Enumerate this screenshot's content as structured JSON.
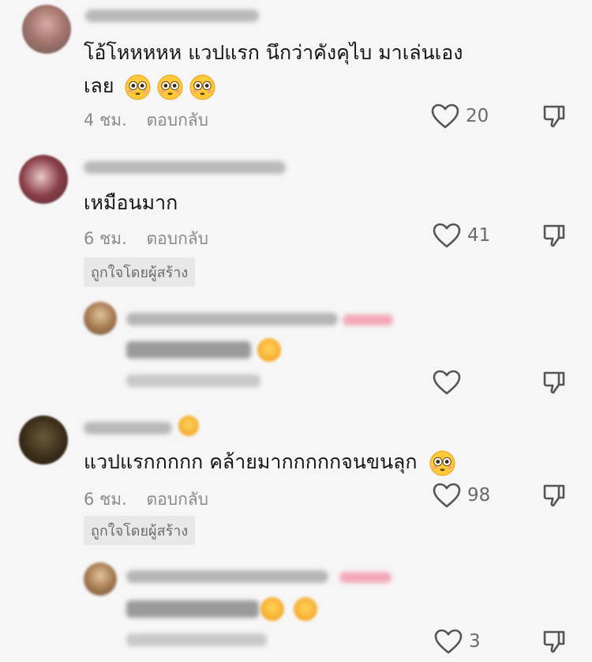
{
  "comments": [
    {
      "text_line1": "โอ้โหหหหห แวปแรก นึกว่าคังคุไบ มาเล่นเอง",
      "text_line2": "เลย",
      "time": "4 ชม.",
      "reply": "ตอบกลับ",
      "likes": "20",
      "emoji_icons": [
        "flushed-face-icon",
        "flushed-face-icon",
        "flushed-face-icon"
      ]
    },
    {
      "text": "เหมือนมาก",
      "time": "6 ชม.",
      "reply": "ตอบกลับ",
      "likes": "41",
      "badge": "ถูกใจโดยผู้สร้าง"
    },
    {
      "text": "แวปแรกกกกก คล้ายมากกกกกจนขนลุก",
      "time": "6 ชม.",
      "reply": "ตอบกลับ",
      "likes": "98",
      "badge": "ถูกใจโดยผู้สร้าง",
      "emoji_icons": [
        "flushed-face-icon"
      ]
    }
  ],
  "replies": [
    {
      "likes": ""
    },
    {
      "likes": "3"
    }
  ],
  "colors": {
    "background": "#f6f6f6",
    "text": "#161616",
    "meta": "#8a8a8a",
    "badge_bg": "#e8e8e8",
    "emoji_yellow": "#ffc93a"
  }
}
